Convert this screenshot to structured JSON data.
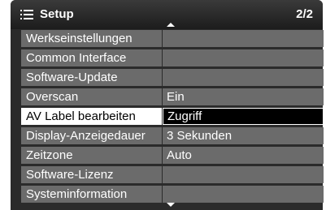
{
  "header": {
    "icon": "menu-list-icon",
    "title": "Setup",
    "page_indicator": "2/2"
  },
  "items": [
    {
      "label": "Werkseinstellungen",
      "value": ""
    },
    {
      "label": "Common Interface",
      "value": ""
    },
    {
      "label": "Software-Update",
      "value": ""
    },
    {
      "label": "Overscan",
      "value": "Ein"
    },
    {
      "label": "AV Label bearbeiten",
      "value": "Zugriff",
      "selected": true
    },
    {
      "label": "Display-Anzeigedauer",
      "value": "3 Sekunden"
    },
    {
      "label": "Zeitzone",
      "value": "Auto"
    },
    {
      "label": "Software-Lizenz",
      "value": ""
    },
    {
      "label": "Systeminformation",
      "value": ""
    }
  ],
  "colors": {
    "frame": "#2b2b2b",
    "row": "#6b6b6b",
    "selected_label": "#ffffff",
    "selected_value": "#000000"
  }
}
